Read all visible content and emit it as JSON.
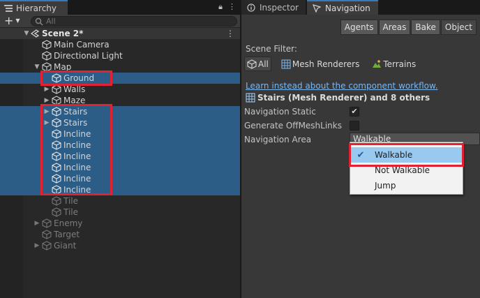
{
  "hierarchy": {
    "tab_label": "Hierarchy",
    "search_placeholder": "All",
    "scene": "Scene 2*",
    "items": [
      {
        "label": "Main Camera"
      },
      {
        "label": "Directional Light"
      },
      {
        "label": "Map"
      },
      {
        "label": "Ground"
      },
      {
        "label": "Walls"
      },
      {
        "label": "Maze"
      },
      {
        "label": "Stairs"
      },
      {
        "label": "Stairs"
      },
      {
        "label": "Incline"
      },
      {
        "label": "Incline"
      },
      {
        "label": "Incline"
      },
      {
        "label": "Incline"
      },
      {
        "label": "Incline"
      },
      {
        "label": "Incline"
      },
      {
        "label": "Tile"
      },
      {
        "label": "Tile"
      },
      {
        "label": "Enemy"
      },
      {
        "label": "Target"
      },
      {
        "label": "Giant"
      }
    ]
  },
  "tabs": {
    "inspector": "Inspector",
    "navigation": "Navigation"
  },
  "navigation": {
    "modes": [
      "Agents",
      "Areas",
      "Bake",
      "Object"
    ],
    "active_mode": "Object",
    "scene_filter_label": "Scene Filter:",
    "filters": [
      "All",
      "Mesh Renderers",
      "Terrains"
    ],
    "link_text": "Learn instead about the component workflow.",
    "object_title": "Stairs (Mesh Renderer) and 8 others",
    "navigation_static_label": "Navigation Static",
    "generate_offmesh_label": "Generate OffMeshLinks",
    "navigation_area_label": "Navigation Area",
    "navigation_area_value": "Walkable",
    "dropdown_options": [
      "Walkable",
      "Not Walkable",
      "Jump"
    ],
    "selected_option": "Walkable"
  },
  "colors": {
    "selection": "#2c5d87",
    "highlight_box": "#e22132",
    "dropdown_highlight": "#99c9ef",
    "link": "#7ab6f0"
  }
}
